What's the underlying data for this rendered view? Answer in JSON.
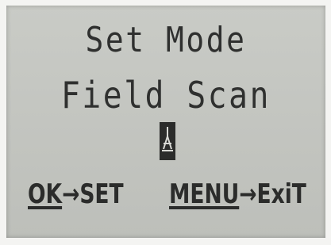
{
  "screen": {
    "title": "Set Mode",
    "value": "Field Scan",
    "cursor_icon": "antenna-cursor-icon"
  },
  "hints": {
    "ok_key": "OK",
    "ok_arrow": "→",
    "ok_action": "SET",
    "menu_key": "MENU",
    "menu_arrow": "→",
    "menu_action": "ExiT"
  }
}
